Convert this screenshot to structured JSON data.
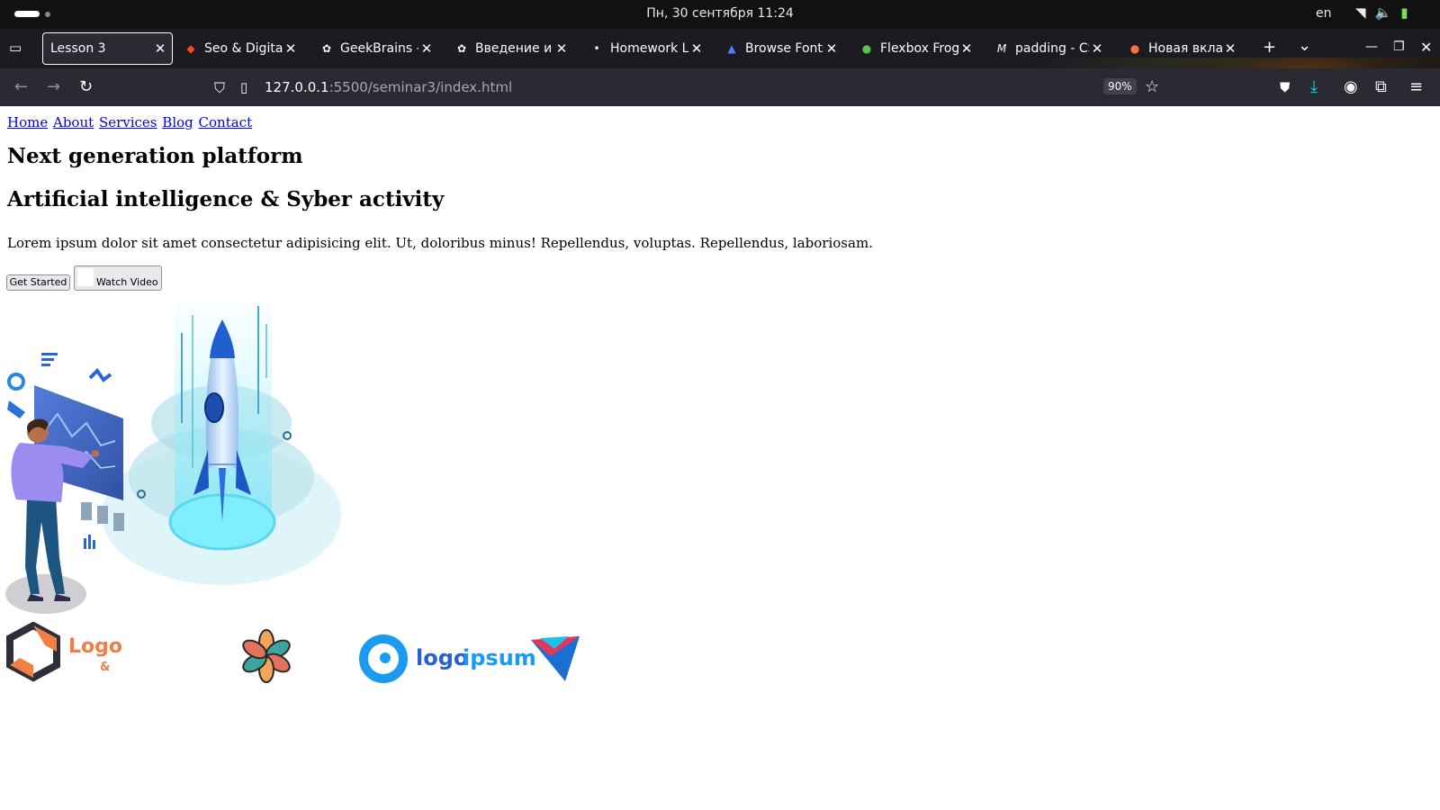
{
  "os": {
    "datetime": "Пн, 30 сентября  11:24",
    "lang": "en"
  },
  "browser": {
    "tabs": [
      {
        "title": "Lesson 3",
        "favicon": "none",
        "active": true
      },
      {
        "title": "Seo & Digital M",
        "favicon": "figma-icon"
      },
      {
        "title": "GeekBrains - c",
        "favicon": "openai-icon"
      },
      {
        "title": "Введение и C",
        "favicon": "openai-icon"
      },
      {
        "title": "Homework Le",
        "favicon": "dot-icon"
      },
      {
        "title": "Browse Fonts",
        "favicon": "google-fonts-icon"
      },
      {
        "title": "Flexbox Frogg",
        "favicon": "frog-icon"
      },
      {
        "title": "padding - CSS",
        "favicon": "mdn-icon"
      },
      {
        "title": "Новая вклад",
        "favicon": "firefox-icon"
      }
    ],
    "url_host": "127.0.0.1",
    "url_rest": ":5500/seminar3/index.html",
    "zoom": "90%"
  },
  "page": {
    "nav": [
      "Home",
      "About",
      "Services",
      "Blog",
      "Contact"
    ],
    "title": "Next generation platform",
    "subtitle": "Artificial intelligence & Syber activity",
    "lead": "Lorem ipsum dolor sit amet consectetur adipisicing elit. Ut, doloribus minus! Repellendus, voluptas. Repellendus, laboriosam.",
    "btn_start": "Get Started",
    "btn_video": "Watch Video",
    "logos": {
      "logo1_word": "Logo",
      "logo1_amp": "&",
      "logo3_a": "logo",
      "logo3_b": "ipsum"
    }
  }
}
